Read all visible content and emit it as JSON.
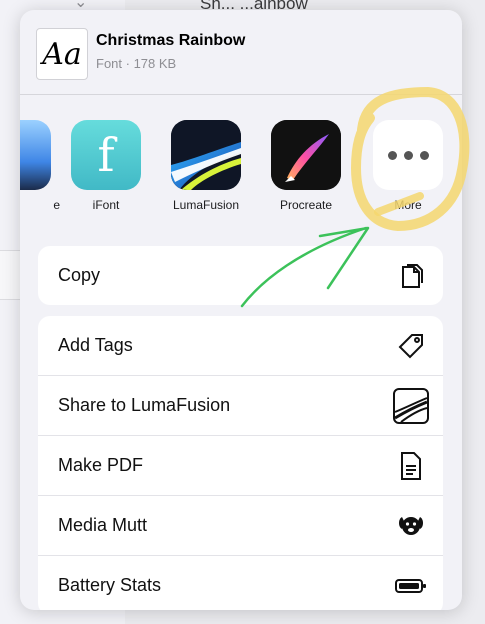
{
  "background": {
    "text": "Sh... ...ainbow"
  },
  "file": {
    "thumb_text": "Aa",
    "title": "Christmas Rainbow",
    "subtitle": "Font · 178 KB"
  },
  "apps": [
    {
      "label": "e",
      "icon": "app-icon-partial"
    },
    {
      "label": "iFont",
      "icon": "ifont-icon",
      "glyph": "f"
    },
    {
      "label": "LumaFusion",
      "icon": "lumafusion-icon"
    },
    {
      "label": "Procreate",
      "icon": "procreate-icon"
    },
    {
      "label": "More",
      "icon": "more-icon"
    }
  ],
  "actions_primary": [
    {
      "label": "Copy",
      "icon": "copy-icon"
    }
  ],
  "actions": [
    {
      "label": "Add Tags",
      "icon": "tag-icon"
    },
    {
      "label": "Share to LumaFusion",
      "icon": "lumafusion-icon"
    },
    {
      "label": "Make PDF",
      "icon": "document-icon"
    },
    {
      "label": "Media Mutt",
      "icon": "dog-icon"
    },
    {
      "label": "Battery Stats",
      "icon": "battery-icon"
    }
  ],
  "colors": {
    "annotation_yellow": "#f5d76e",
    "annotation_green": "#3cc25a"
  }
}
